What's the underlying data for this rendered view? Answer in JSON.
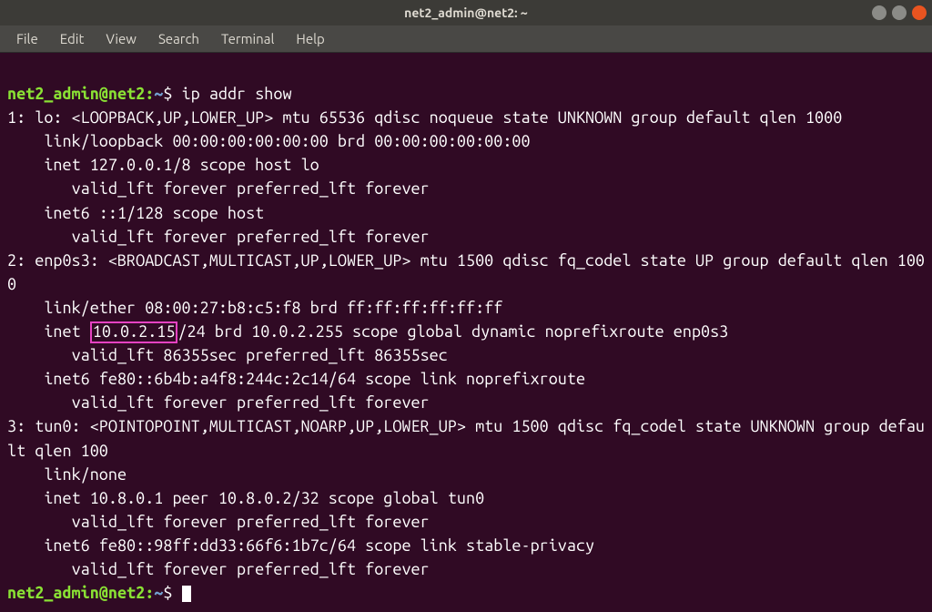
{
  "window": {
    "title": "net2_admin@net2: ~"
  },
  "menu": {
    "file": "File",
    "edit": "Edit",
    "view": "View",
    "search": "Search",
    "terminal": "Terminal",
    "help": "Help"
  },
  "prompt": {
    "user_host": "net2_admin@net2",
    "colon": ":",
    "path": "~",
    "dollar": "$"
  },
  "command": "ip addr show",
  "highlighted_ip": "10.0.2.15",
  "output": {
    "l01": "1: lo: <LOOPBACK,UP,LOWER_UP> mtu 65536 qdisc noqueue state UNKNOWN group default qlen 1000",
    "l02": "    link/loopback 00:00:00:00:00:00 brd 00:00:00:00:00:00",
    "l03": "    inet 127.0.0.1/8 scope host lo",
    "l04": "       valid_lft forever preferred_lft forever",
    "l05": "    inet6 ::1/128 scope host",
    "l06": "       valid_lft forever preferred_lft forever",
    "l07": "2: enp0s3: <BROADCAST,MULTICAST,UP,LOWER_UP> mtu 1500 qdisc fq_codel state UP group default qlen 1000",
    "l08": "    link/ether 08:00:27:b8:c5:f8 brd ff:ff:ff:ff:ff:ff",
    "l09a": "    inet ",
    "l09b": "/24 brd 10.0.2.255 scope global dynamic noprefixroute enp0s3",
    "l10": "       valid_lft 86355sec preferred_lft 86355sec",
    "l11": "    inet6 fe80::6b4b:a4f8:244c:2c14/64 scope link noprefixroute",
    "l12": "       valid_lft forever preferred_lft forever",
    "l13": "3: tun0: <POINTOPOINT,MULTICAST,NOARP,UP,LOWER_UP> mtu 1500 qdisc fq_codel state UNKNOWN group default qlen 100",
    "l14": "    link/none",
    "l15": "    inet 10.8.0.1 peer 10.8.0.2/32 scope global tun0",
    "l16": "       valid_lft forever preferred_lft forever",
    "l17": "    inet6 fe80::98ff:dd33:66f6:1b7c/64 scope link stable-privacy",
    "l18": "       valid_lft forever preferred_lft forever"
  }
}
